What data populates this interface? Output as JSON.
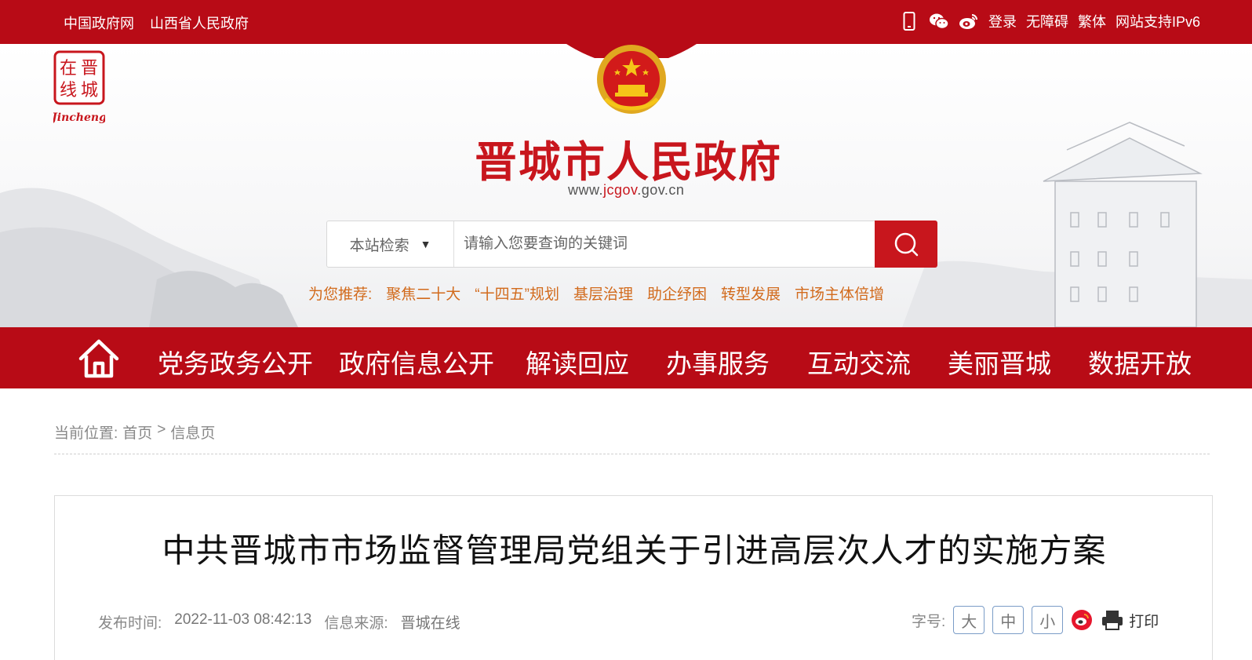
{
  "topbar": {
    "links": [
      "中国政府网",
      "山西省人民政府"
    ],
    "login": "登录",
    "accessibility": "无障碍",
    "traditional": "繁体",
    "ipv6": "网站支持IPv6",
    "icons": [
      "mobile-icon",
      "wechat-icon",
      "weibo-icon"
    ]
  },
  "header": {
    "logo_text": [
      "晋",
      "城",
      "在",
      "线"
    ],
    "logo_caption": "Jincheng",
    "title": "晋城市人民政府",
    "url_prefix": "www.",
    "url_main": "jcgov",
    "url_suffix": ".gov.cn"
  },
  "search": {
    "scope": "本站检索",
    "placeholder": "请输入您要查询的关键词"
  },
  "recommend": {
    "label": "为您推荐:",
    "keywords": [
      "聚焦二十大",
      "“十四五”规划",
      "基层治理",
      "助企纾困",
      "转型发展",
      "市场主体倍增"
    ]
  },
  "nav": {
    "items": [
      "党务政务公开",
      "政府信息公开",
      "解读回应",
      "办事服务",
      "互动交流",
      "美丽晋城",
      "数据开放"
    ]
  },
  "breadcrumb": {
    "label": "当前位置:",
    "home": "首页",
    "sep": ">",
    "current": "信息页"
  },
  "article": {
    "title": "中共晋城市市场监督管理局党组关于引进高层次人才的实施方案",
    "publish_label": "发布时间:",
    "publish_time": "2022-11-03 08:42:13",
    "source_label": "信息来源:",
    "source": "晋城在线",
    "font_label": "字号:",
    "font_large": "大",
    "font_medium": "中",
    "font_small": "小",
    "print": "打印"
  },
  "colors": {
    "brand_red": "#b80b16",
    "title_red": "#c8161d",
    "recommend_orange": "#d26b1d"
  }
}
